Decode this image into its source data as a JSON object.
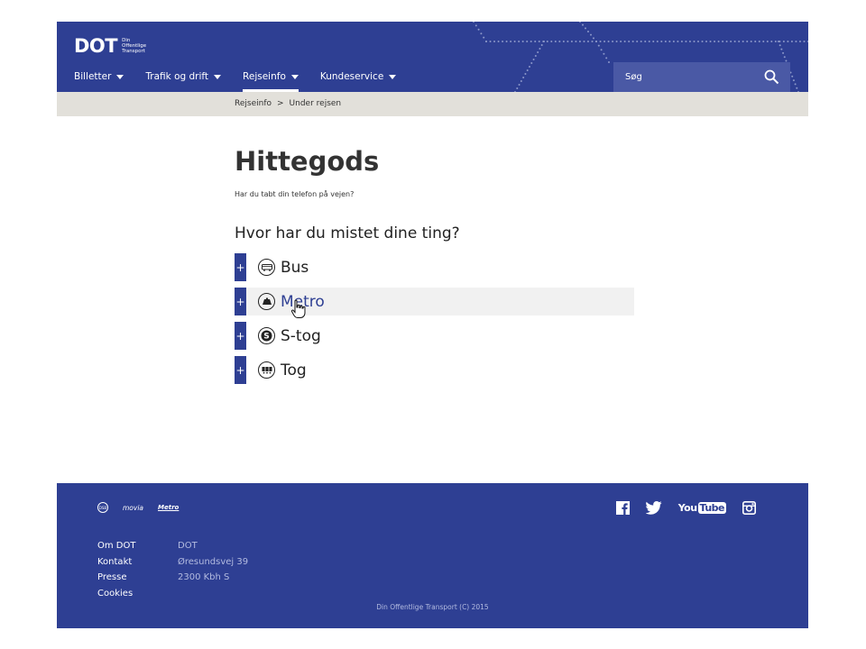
{
  "header": {
    "logo": {
      "mark": "DOT",
      "sub_lines": [
        "Din",
        "Offentlige",
        "Transport"
      ]
    },
    "nav": [
      {
        "label": "Billetter",
        "active": false
      },
      {
        "label": "Trafik og drift",
        "active": false
      },
      {
        "label": "Rejseinfo",
        "active": true
      },
      {
        "label": "Kundeservice",
        "active": false
      }
    ],
    "search": {
      "placeholder": "Søg",
      "value": "",
      "icon": "search-icon"
    }
  },
  "breadcrumb": {
    "items": [
      "Rejseinfo",
      "Under rejsen"
    ],
    "separator": ">"
  },
  "main": {
    "title": "Hittegods",
    "intro": "Har du tabt din telefon på vejen?",
    "subheading": "Hvor har du mistet dine ting?",
    "accordion": [
      {
        "label": "Bus",
        "icon": "bus-icon",
        "toggle": "+"
      },
      {
        "label": "Metro",
        "icon": "metro-icon",
        "toggle": "+",
        "hovered": true
      },
      {
        "label": "S-tog",
        "icon": "s-train-icon",
        "toggle": "+"
      },
      {
        "label": "Tog",
        "icon": "train-icon",
        "toggle": "+"
      }
    ]
  },
  "footer": {
    "partners": [
      "DSB",
      "movia",
      "Metro"
    ],
    "links": [
      "Om DOT",
      "Kontakt",
      "Presse",
      "Cookies"
    ],
    "address": [
      "DOT",
      "Øresundsvej 39",
      "2300 Kbh S"
    ],
    "social": [
      "facebook-icon",
      "twitter-icon",
      "youtube-icon",
      "instagram-icon"
    ],
    "youtube_text": "YouTube",
    "copyright": "Din Offentlige Transport (C) 2015"
  },
  "colors": {
    "brand": "#2e3f93",
    "breadcrumb_bg": "#e2e0da",
    "hover_row_bg": "#f1f1f1",
    "footer_muted_text": "#b3bbe0"
  }
}
